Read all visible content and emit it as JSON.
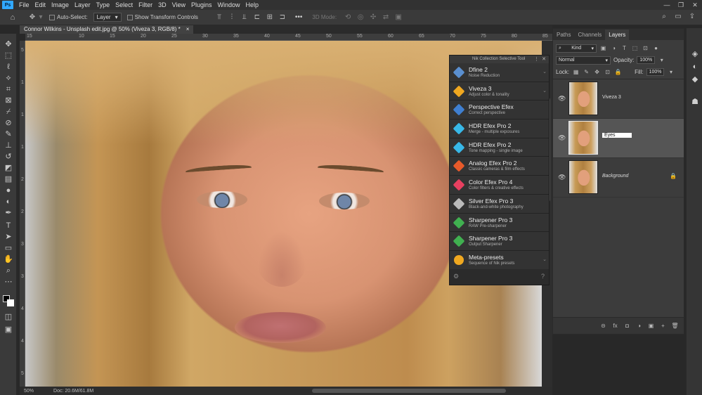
{
  "menubar": {
    "logo": "Ps",
    "items": [
      "File",
      "Edit",
      "Image",
      "Layer",
      "Type",
      "Select",
      "Filter",
      "3D",
      "View",
      "Plugins",
      "Window",
      "Help"
    ],
    "window_controls": [
      "—",
      "❐",
      "✕"
    ]
  },
  "options_bar": {
    "home_icon": "home-icon",
    "move_icon": "move-icon",
    "auto_select_label": "Auto-Select:",
    "auto_select_value": "Layer",
    "show_transform_label": "Show Transform Controls",
    "more_label": "•••",
    "mode_3d_label": "3D Mode:"
  },
  "document": {
    "tab_title": "Connor Wilkins - Unsplash edit.jpg @ 50% (Viveza 3, RGB/8) *",
    "tab_close": "×",
    "zoom": "50%",
    "doc_size": "Doc: 20.6M/61.8M"
  },
  "ruler": {
    "top_ticks": [
      "15",
      "10",
      "15",
      "20",
      "25",
      "30",
      "35",
      "40",
      "45",
      "50",
      "55",
      "60",
      "65",
      "70",
      "75",
      "80",
      "85"
    ],
    "left_ticks": [
      "5",
      "1",
      "1",
      "1",
      "2",
      "2",
      "3",
      "3",
      "4",
      "4",
      "5"
    ]
  },
  "nik_panel": {
    "title": "Nik Collection Selective Tool",
    "items": [
      {
        "name": "Dfine 2",
        "desc": "Noise Reduction",
        "color": "#5a8fd0"
      },
      {
        "name": "Viveza 3",
        "desc": "Adjust color & tonality",
        "color": "#f0a820"
      },
      {
        "name": "Perspective Efex",
        "desc": "Correct perspective",
        "color": "#3f7fd0"
      },
      {
        "name": "HDR Efex Pro 2",
        "desc": "Merge - multiple exposures",
        "color": "#38b8e8"
      },
      {
        "name": "HDR Efex Pro 2",
        "desc": "Tone mapping - single image",
        "color": "#38b8e8"
      },
      {
        "name": "Analog Efex Pro 2",
        "desc": "Classic cameras & film effects",
        "color": "#e85a2a"
      },
      {
        "name": "Color Efex Pro 4",
        "desc": "Color filters & creative effects",
        "color": "#e84060"
      },
      {
        "name": "Silver Efex Pro 3",
        "desc": "Black-and-white photography",
        "color": "#bbbbbb"
      },
      {
        "name": "Sharpener Pro 3",
        "desc": "RAW Pre-sharpener",
        "color": "#40b050"
      },
      {
        "name": "Sharpener Pro 3",
        "desc": "Output Sharpener",
        "color": "#40b050"
      },
      {
        "name": "Meta-presets",
        "desc": "Sequence of Nik presets",
        "color": "#f0a820"
      }
    ]
  },
  "layers_panel": {
    "tabs": [
      "Paths",
      "Channels",
      "Layers"
    ],
    "kind_label": "Kind",
    "blend_mode": "Normal",
    "opacity_label": "Opacity:",
    "opacity_value": "100%",
    "lock_label": "Lock:",
    "fill_label": "Fill:",
    "fill_value": "100%",
    "layers": [
      {
        "name": "Viveza 3",
        "active": false
      },
      {
        "name": "Eyes",
        "active": true
      },
      {
        "name": "Background",
        "active": false
      }
    ],
    "bottom_icons": [
      "⊝",
      "fx",
      "◘",
      "◑",
      "▣",
      "+",
      "🗑"
    ]
  }
}
